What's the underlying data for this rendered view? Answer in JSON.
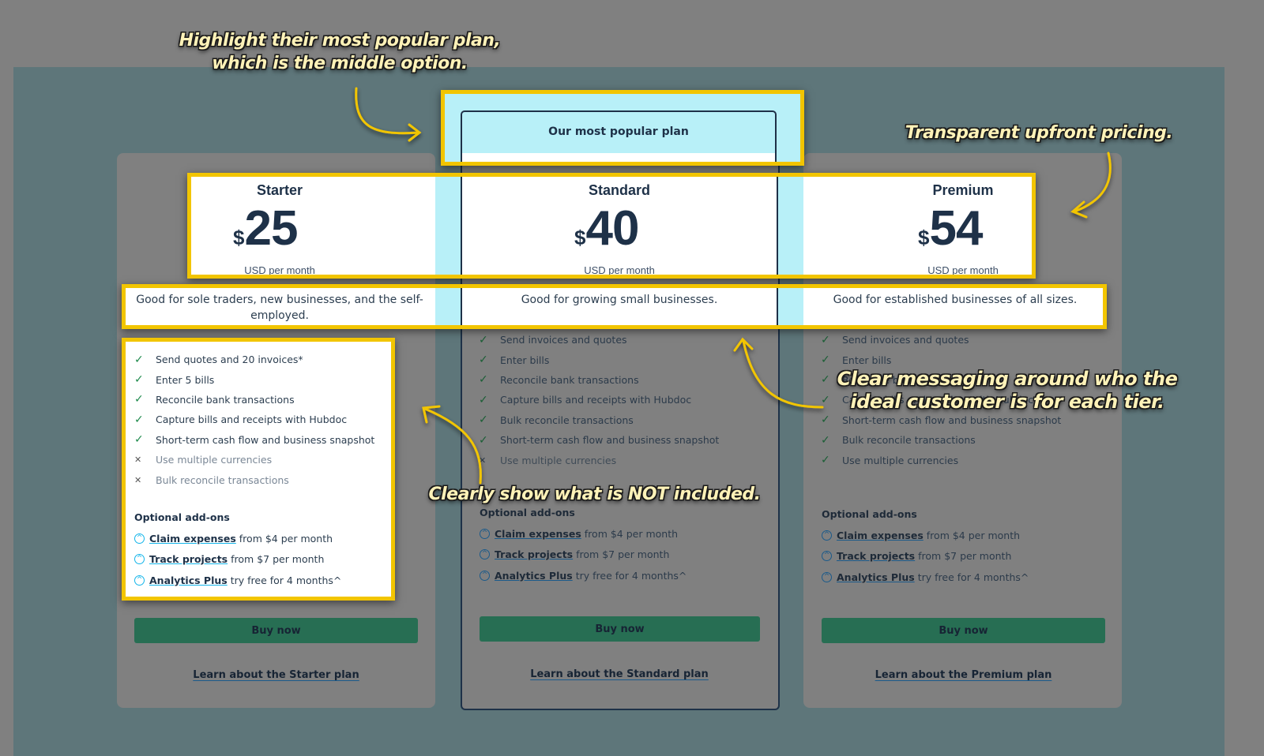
{
  "popular_banner": "Our most popular plan",
  "plans": [
    {
      "name": "Starter",
      "currency_symbol": "$",
      "price": "25",
      "period": "USD per month",
      "description": "Good for sole traders, new businesses, and the self-employed.",
      "features": [
        {
          "text": "Send quotes and 20 invoices*",
          "included": true
        },
        {
          "text": "Enter 5 bills",
          "included": true
        },
        {
          "text": "Reconcile bank transactions",
          "included": true
        },
        {
          "text": "Capture bills and receipts with Hubdoc",
          "included": true
        },
        {
          "text": "Short-term cash flow and business snapshot",
          "included": true
        },
        {
          "text": "Use multiple currencies",
          "included": false
        },
        {
          "text": "Bulk reconcile transactions",
          "included": false
        }
      ],
      "addons_title": "Optional add-ons",
      "addons": [
        {
          "link": "Claim expenses",
          "rest": "from $4 per month"
        },
        {
          "link": "Track projects",
          "rest": "from $7 per month"
        },
        {
          "link": "Analytics Plus",
          "rest": "try free for 4 months^"
        }
      ],
      "buy_label": "Buy now",
      "learn_label": "Learn about the Starter plan"
    },
    {
      "name": "Standard",
      "currency_symbol": "$",
      "price": "40",
      "period": "USD per month",
      "description": "Good for growing small businesses.",
      "features": [
        {
          "text": "Send invoices and quotes",
          "included": true
        },
        {
          "text": "Enter bills",
          "included": true
        },
        {
          "text": "Reconcile bank transactions",
          "included": true
        },
        {
          "text": "Capture bills and receipts with Hubdoc",
          "included": true
        },
        {
          "text": "Bulk reconcile transactions",
          "included": true
        },
        {
          "text": "Short-term cash flow and business snapshot",
          "included": true
        },
        {
          "text": "Use multiple currencies",
          "included": false
        }
      ],
      "addons_title": "Optional add-ons",
      "addons": [
        {
          "link": "Claim expenses",
          "rest": "from $4 per month"
        },
        {
          "link": "Track projects",
          "rest": "from $7 per month"
        },
        {
          "link": "Analytics Plus",
          "rest": "try free for 4 months^"
        }
      ],
      "buy_label": "Buy now",
      "learn_label": "Learn about the Standard plan"
    },
    {
      "name": "Premium",
      "currency_symbol": "$",
      "price": "54",
      "period": "USD per month",
      "description": "Good for established businesses of all sizes.",
      "features": [
        {
          "text": "Send invoices and quotes",
          "included": true
        },
        {
          "text": "Enter bills",
          "included": true
        },
        {
          "text": "Reconcile bank transactions",
          "included": true
        },
        {
          "text": "Capture bills and receipts with Hubdoc",
          "included": true
        },
        {
          "text": "Short-term cash flow and business snapshot",
          "included": true
        },
        {
          "text": "Bulk reconcile transactions",
          "included": true
        },
        {
          "text": "Use multiple currencies",
          "included": true
        }
      ],
      "addons_title": "Optional add-ons",
      "addons": [
        {
          "link": "Claim expenses",
          "rest": "from $4 per month"
        },
        {
          "link": "Track projects",
          "rest": "from $7 per month"
        },
        {
          "link": "Analytics Plus",
          "rest": "try free for 4 months^"
        }
      ],
      "buy_label": "Buy now",
      "learn_label": "Learn about the Premium plan"
    }
  ],
  "annotations": {
    "popular": "Highlight their most popular plan, which is the middle option.",
    "pricing": "Transparent upfront pricing.",
    "messaging": "Clear messaging around who the ideal customer is for each tier.",
    "not_included": "Clearly show what is NOT included."
  },
  "icons": {
    "included": "✓",
    "excluded": "✕",
    "addon": "^"
  },
  "colors": {
    "annotation_yellow": "#f2c500",
    "annotation_text": "#fff2b8",
    "buy_button_green": "#276e53",
    "popular_band_cyan": "#b8f0f8",
    "page_teal": "#5e767a",
    "text_navy": "#1e3148",
    "check_green": "#1e8a4c",
    "addon_blue": "#13b5ea"
  }
}
